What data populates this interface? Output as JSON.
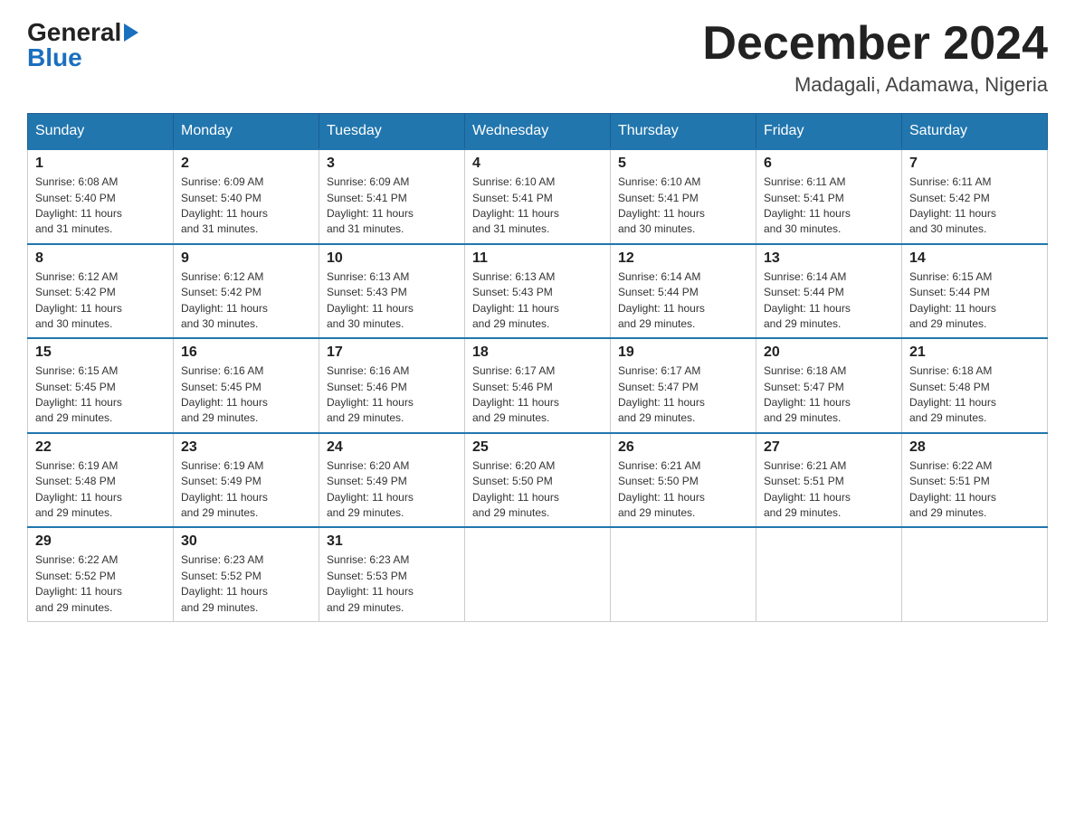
{
  "header": {
    "logo_general": "General",
    "logo_blue": "Blue",
    "month_title": "December 2024",
    "location": "Madagali, Adamawa, Nigeria"
  },
  "days_of_week": [
    "Sunday",
    "Monday",
    "Tuesday",
    "Wednesday",
    "Thursday",
    "Friday",
    "Saturday"
  ],
  "weeks": [
    [
      {
        "day": "1",
        "sunrise": "6:08 AM",
        "sunset": "5:40 PM",
        "daylight": "11 hours and 31 minutes."
      },
      {
        "day": "2",
        "sunrise": "6:09 AM",
        "sunset": "5:40 PM",
        "daylight": "11 hours and 31 minutes."
      },
      {
        "day": "3",
        "sunrise": "6:09 AM",
        "sunset": "5:41 PM",
        "daylight": "11 hours and 31 minutes."
      },
      {
        "day": "4",
        "sunrise": "6:10 AM",
        "sunset": "5:41 PM",
        "daylight": "11 hours and 31 minutes."
      },
      {
        "day": "5",
        "sunrise": "6:10 AM",
        "sunset": "5:41 PM",
        "daylight": "11 hours and 30 minutes."
      },
      {
        "day": "6",
        "sunrise": "6:11 AM",
        "sunset": "5:41 PM",
        "daylight": "11 hours and 30 minutes."
      },
      {
        "day": "7",
        "sunrise": "6:11 AM",
        "sunset": "5:42 PM",
        "daylight": "11 hours and 30 minutes."
      }
    ],
    [
      {
        "day": "8",
        "sunrise": "6:12 AM",
        "sunset": "5:42 PM",
        "daylight": "11 hours and 30 minutes."
      },
      {
        "day": "9",
        "sunrise": "6:12 AM",
        "sunset": "5:42 PM",
        "daylight": "11 hours and 30 minutes."
      },
      {
        "day": "10",
        "sunrise": "6:13 AM",
        "sunset": "5:43 PM",
        "daylight": "11 hours and 30 minutes."
      },
      {
        "day": "11",
        "sunrise": "6:13 AM",
        "sunset": "5:43 PM",
        "daylight": "11 hours and 29 minutes."
      },
      {
        "day": "12",
        "sunrise": "6:14 AM",
        "sunset": "5:44 PM",
        "daylight": "11 hours and 29 minutes."
      },
      {
        "day": "13",
        "sunrise": "6:14 AM",
        "sunset": "5:44 PM",
        "daylight": "11 hours and 29 minutes."
      },
      {
        "day": "14",
        "sunrise": "6:15 AM",
        "sunset": "5:44 PM",
        "daylight": "11 hours and 29 minutes."
      }
    ],
    [
      {
        "day": "15",
        "sunrise": "6:15 AM",
        "sunset": "5:45 PM",
        "daylight": "11 hours and 29 minutes."
      },
      {
        "day": "16",
        "sunrise": "6:16 AM",
        "sunset": "5:45 PM",
        "daylight": "11 hours and 29 minutes."
      },
      {
        "day": "17",
        "sunrise": "6:16 AM",
        "sunset": "5:46 PM",
        "daylight": "11 hours and 29 minutes."
      },
      {
        "day": "18",
        "sunrise": "6:17 AM",
        "sunset": "5:46 PM",
        "daylight": "11 hours and 29 minutes."
      },
      {
        "day": "19",
        "sunrise": "6:17 AM",
        "sunset": "5:47 PM",
        "daylight": "11 hours and 29 minutes."
      },
      {
        "day": "20",
        "sunrise": "6:18 AM",
        "sunset": "5:47 PM",
        "daylight": "11 hours and 29 minutes."
      },
      {
        "day": "21",
        "sunrise": "6:18 AM",
        "sunset": "5:48 PM",
        "daylight": "11 hours and 29 minutes."
      }
    ],
    [
      {
        "day": "22",
        "sunrise": "6:19 AM",
        "sunset": "5:48 PM",
        "daylight": "11 hours and 29 minutes."
      },
      {
        "day": "23",
        "sunrise": "6:19 AM",
        "sunset": "5:49 PM",
        "daylight": "11 hours and 29 minutes."
      },
      {
        "day": "24",
        "sunrise": "6:20 AM",
        "sunset": "5:49 PM",
        "daylight": "11 hours and 29 minutes."
      },
      {
        "day": "25",
        "sunrise": "6:20 AM",
        "sunset": "5:50 PM",
        "daylight": "11 hours and 29 minutes."
      },
      {
        "day": "26",
        "sunrise": "6:21 AM",
        "sunset": "5:50 PM",
        "daylight": "11 hours and 29 minutes."
      },
      {
        "day": "27",
        "sunrise": "6:21 AM",
        "sunset": "5:51 PM",
        "daylight": "11 hours and 29 minutes."
      },
      {
        "day": "28",
        "sunrise": "6:22 AM",
        "sunset": "5:51 PM",
        "daylight": "11 hours and 29 minutes."
      }
    ],
    [
      {
        "day": "29",
        "sunrise": "6:22 AM",
        "sunset": "5:52 PM",
        "daylight": "11 hours and 29 minutes."
      },
      {
        "day": "30",
        "sunrise": "6:23 AM",
        "sunset": "5:52 PM",
        "daylight": "11 hours and 29 minutes."
      },
      {
        "day": "31",
        "sunrise": "6:23 AM",
        "sunset": "5:53 PM",
        "daylight": "11 hours and 29 minutes."
      },
      null,
      null,
      null,
      null
    ]
  ],
  "labels": {
    "sunrise": "Sunrise:",
    "sunset": "Sunset:",
    "daylight": "Daylight:"
  }
}
